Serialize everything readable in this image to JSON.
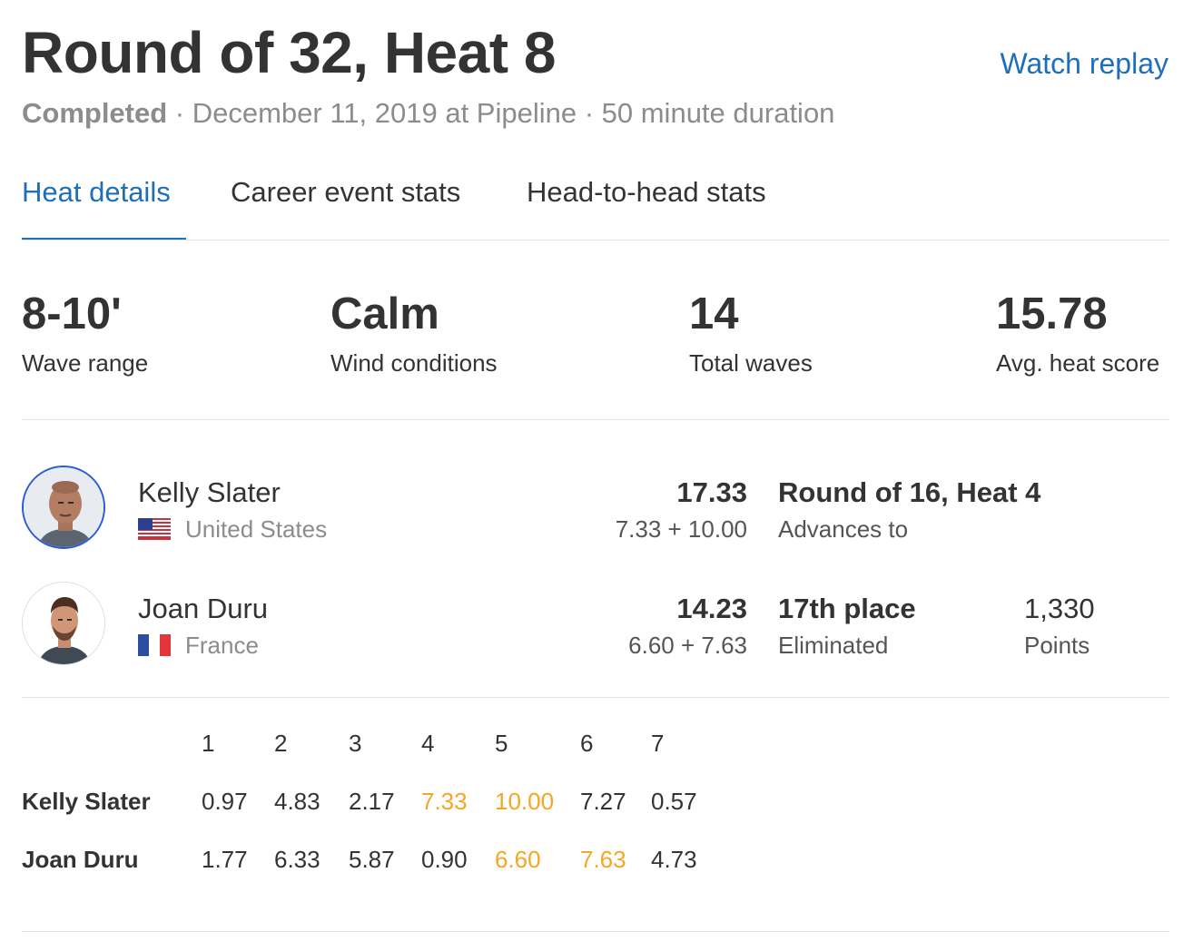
{
  "header": {
    "title": "Round of 32, Heat 8",
    "replay_label": "Watch replay",
    "status": "Completed",
    "details": " · December 11, 2019 at Pipeline · 50 minute duration"
  },
  "tabs": [
    {
      "label": "Heat details",
      "active": true
    },
    {
      "label": "Career event stats",
      "active": false
    },
    {
      "label": "Head-to-head stats",
      "active": false
    }
  ],
  "stats": [
    {
      "value": "8-10'",
      "label": "Wave range"
    },
    {
      "value": "Calm",
      "label": "Wind conditions"
    },
    {
      "value": "14",
      "label": "Total waves"
    },
    {
      "value": "15.78",
      "label": "Avg. heat score"
    }
  ],
  "athletes": [
    {
      "name": "Kelly Slater",
      "country": "United States",
      "flag": "us-flag",
      "total": "17.33",
      "breakdown": "7.33 + 10.00",
      "result_main": "Round of 16, Heat 4",
      "result_sub": "Advances to",
      "points_value": "",
      "points_label": ""
    },
    {
      "name": "Joan Duru",
      "country": "France",
      "flag": "fr-flag",
      "total": "14.23",
      "breakdown": "6.60 + 7.63",
      "result_main": "17th place",
      "result_sub": "Eliminated",
      "points_value": "1,330",
      "points_label": "Points"
    }
  ],
  "wave_table": {
    "columns": [
      "1",
      "2",
      "3",
      "4",
      "5",
      "6",
      "7"
    ],
    "rows": [
      {
        "name": "Kelly Slater",
        "scores": [
          "0.97",
          "4.83",
          "2.17",
          "7.33",
          "10.00",
          "7.27",
          "0.57"
        ],
        "counted": [
          3,
          4
        ]
      },
      {
        "name": "Joan Duru",
        "scores": [
          "1.77",
          "6.33",
          "5.87",
          "0.90",
          "6.60",
          "7.63",
          "4.73"
        ],
        "counted": [
          4,
          5
        ]
      }
    ]
  },
  "colors": {
    "accent": "#1f6fb8",
    "counted_score": "#f5a623",
    "muted": "#8c8c8c",
    "text": "#333333"
  }
}
